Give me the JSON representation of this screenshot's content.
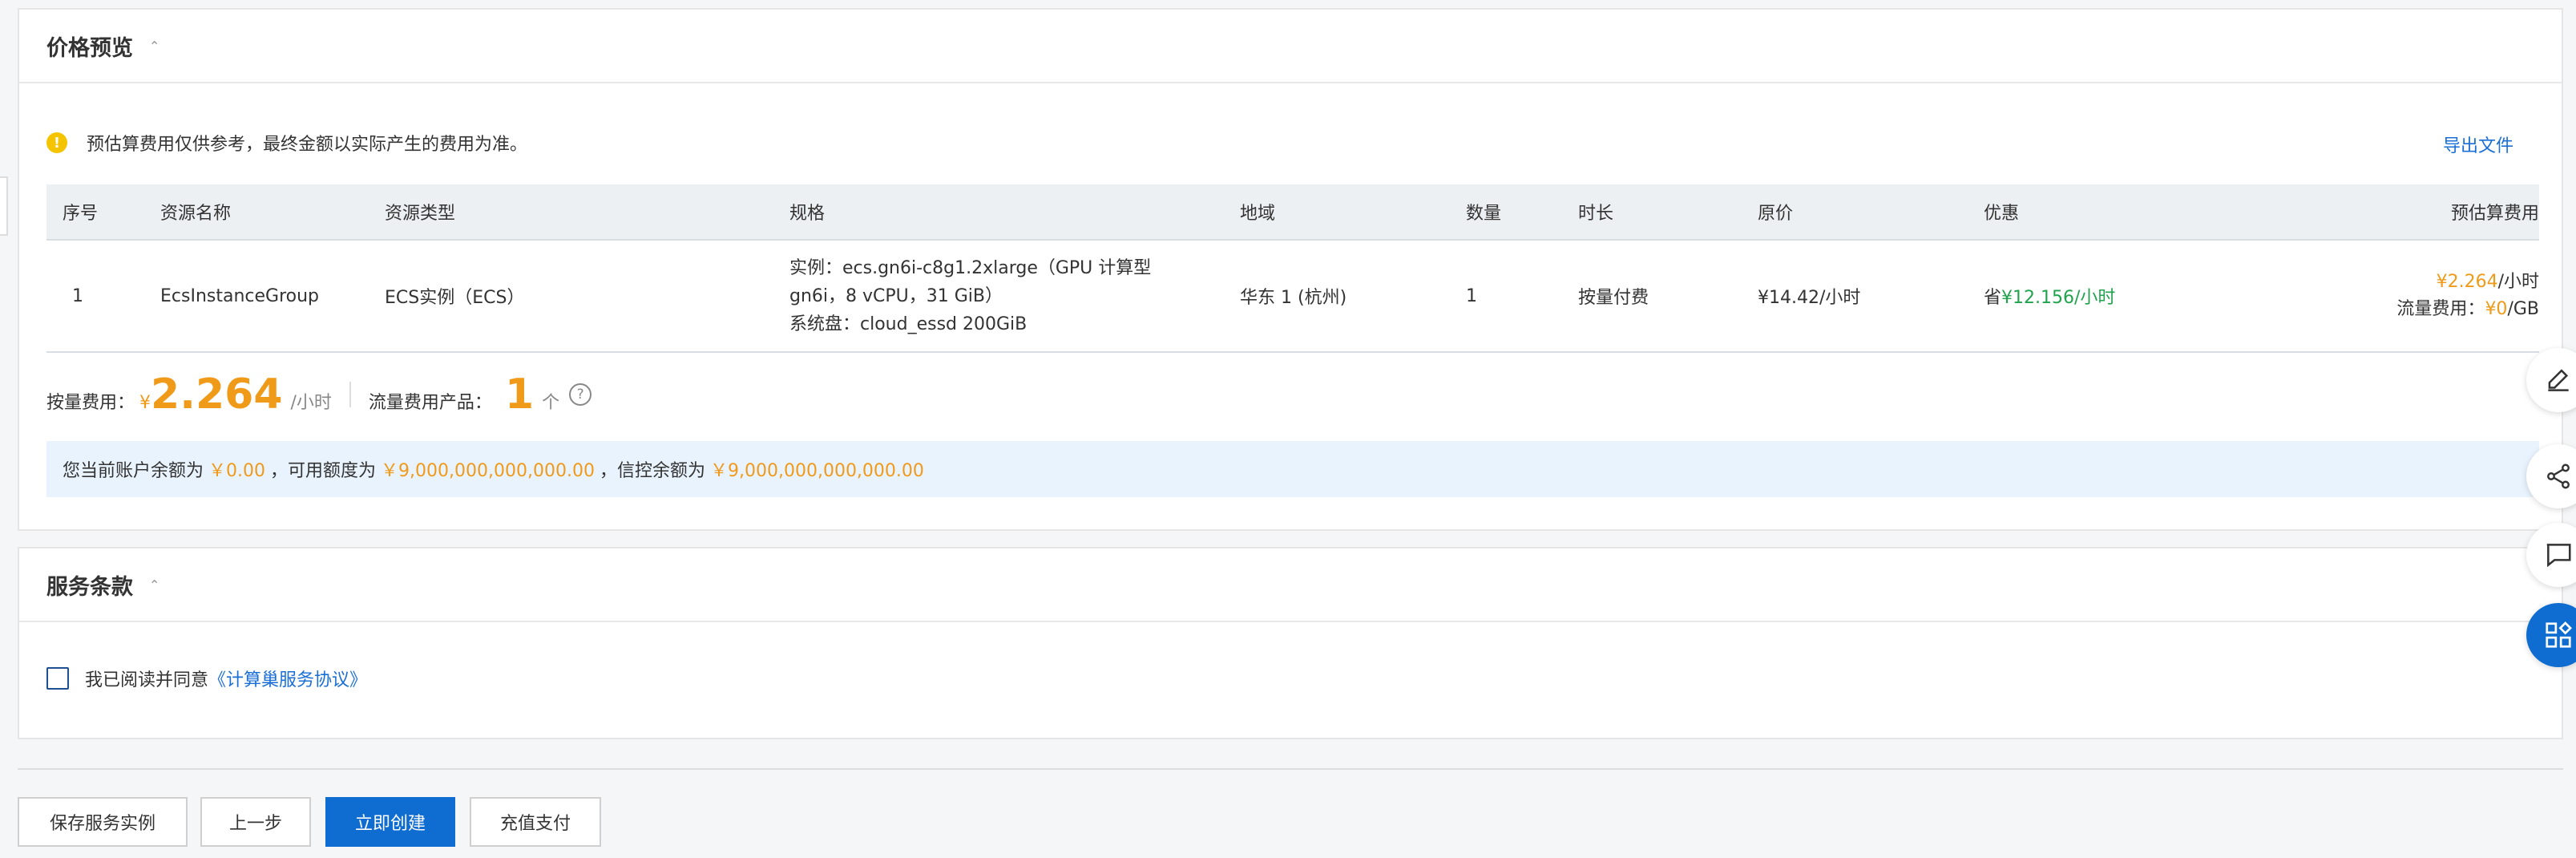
{
  "price_panel": {
    "title": "价格预览",
    "notice": "预估算费用仅供参考，最终金额以实际产生的费用为准。",
    "export_label": "导出文件",
    "columns": [
      "序号",
      "资源名称",
      "资源类型",
      "规格",
      "地域",
      "数量",
      "时长",
      "原价",
      "优惠",
      "预估算费用"
    ],
    "rows": [
      {
        "index": "1",
        "name": "EcsInstanceGroup",
        "type": "ECS实例（ECS）",
        "spec_line1": "实例：ecs.gn6i-c8g1.2xlarge（GPU 计算型",
        "spec_line2": "gn6i，8 vCPU，31 GiB）",
        "spec_line3": "系统盘：cloud_essd 200GiB",
        "region": "华东 1 (杭州)",
        "quantity": "1",
        "duration": "按量付费",
        "original_price": "¥14.42/小时",
        "discount_prefix": "省",
        "discount_value": "¥12.156/小时",
        "estimate_price": "¥2.264",
        "estimate_unit": "/小时",
        "traffic_label": "流量费用：",
        "traffic_price": "¥0",
        "traffic_unit": "/GB"
      }
    ],
    "summary": {
      "payg_label": "按量费用：",
      "currency": "¥",
      "payg_value": "2.264",
      "payg_unit": "/小时",
      "traffic_label": "流量费用产品：",
      "traffic_count": "1",
      "traffic_unit": "个"
    },
    "balance": {
      "text1": "您当前账户余额为",
      "balance": "￥0.00",
      "text2": "，可用额度为",
      "available": "￥9,000,000,000,000.00",
      "text3": "，信控余额为",
      "credit": "￥9,000,000,000,000.00"
    }
  },
  "service_panel": {
    "title": "服务条款",
    "agree_text": "我已阅读并同意",
    "agreement_link": "《计算巢服务协议》"
  },
  "footer": {
    "save_label": "保存服务实例",
    "prev_label": "上一步",
    "create_label": "立即创建",
    "recharge_label": "充值支付"
  },
  "icons": {
    "float_buttons": [
      "edit-icon",
      "share-icon",
      "feedback-icon",
      "apps-icon"
    ]
  },
  "colors": {
    "accent": "#0f6cd0",
    "price_orange": "#f09a1a",
    "discount_green": "#21a34e"
  }
}
